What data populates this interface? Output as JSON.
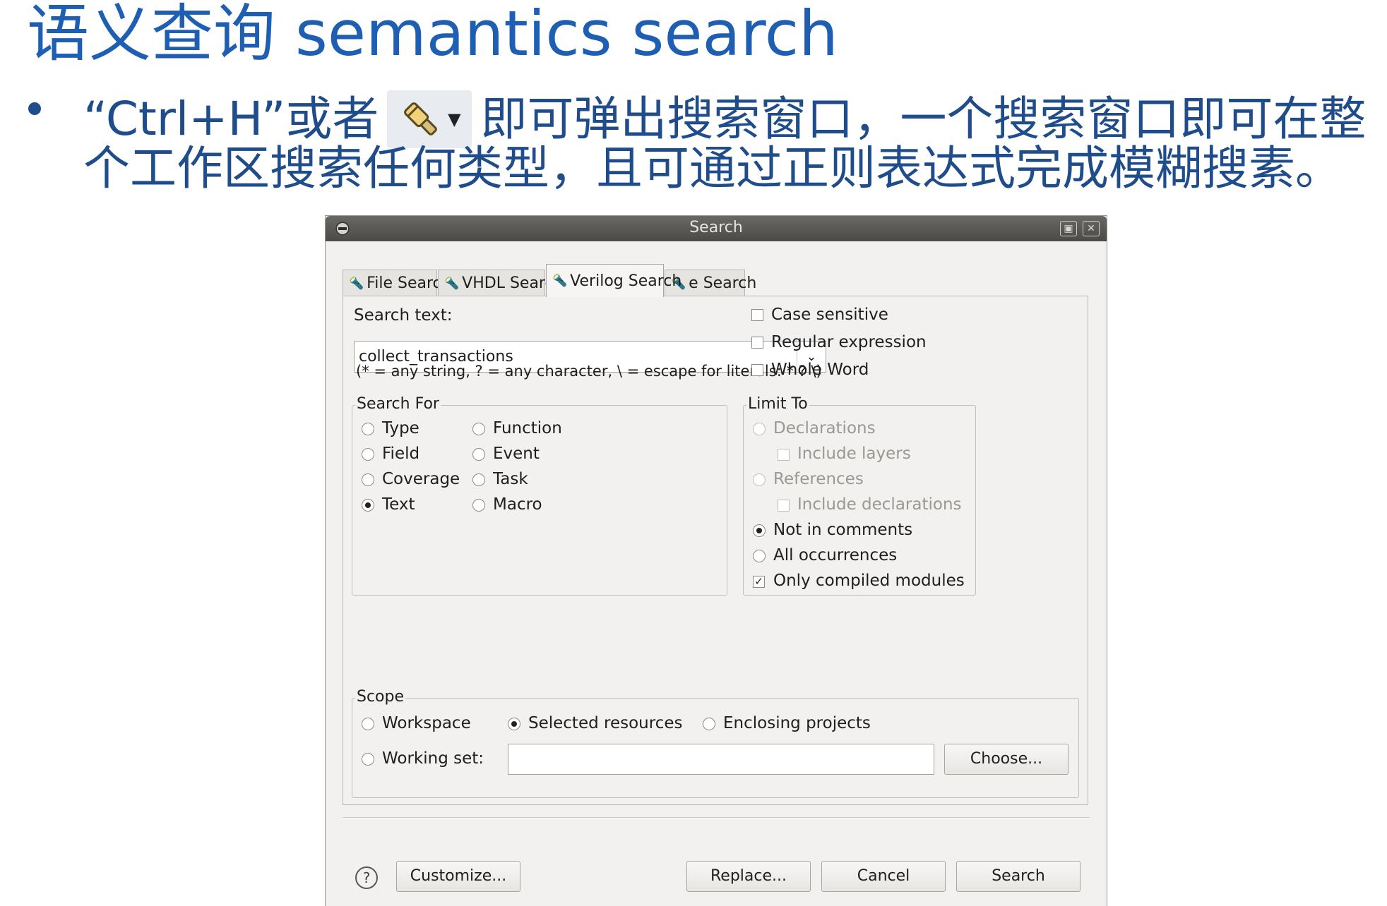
{
  "slide": {
    "title": "语义查询 semantics search",
    "bullet_line1_pre": "“Ctrl+H”或者",
    "bullet_line1_post": "即可弹出搜索窗口，一个搜索窗口即可在整",
    "bullet_line2": "个工作区搜索任何类型，且可通过正则表达式完成模糊搜素。",
    "toolbar_icon": "search-tool-icon"
  },
  "dialog": {
    "title": "Search",
    "tabs": [
      {
        "label": "File Search",
        "icon": "file-search-icon"
      },
      {
        "label": "VHDL Search",
        "icon": "vhdl-search-icon"
      },
      {
        "label": "Verilog Search",
        "icon": "verilog-search-icon",
        "active": true
      },
      {
        "label": "e Search",
        "icon": "e-search-icon"
      }
    ],
    "search_text_label": "Search text:",
    "search_text_value": "collect_transactions",
    "hint": "(* = any string, ? = any character, \\ = escape for literals: * ? \\)",
    "options": {
      "case_sensitive": {
        "label": "Case sensitive",
        "checked": false
      },
      "regular_expression": {
        "label": "Regular expression",
        "checked": false
      },
      "whole_word": {
        "label": "Whole Word",
        "checked": false
      }
    },
    "search_for": {
      "legend": "Search For",
      "items": [
        {
          "label": "Type",
          "selected": false
        },
        {
          "label": "Field",
          "selected": false
        },
        {
          "label": "Coverage",
          "selected": false
        },
        {
          "label": "Text",
          "selected": true
        },
        {
          "label": "Function",
          "selected": false
        },
        {
          "label": "Event",
          "selected": false
        },
        {
          "label": "Task",
          "selected": false
        },
        {
          "label": "Macro",
          "selected": false
        }
      ]
    },
    "limit_to": {
      "legend": "Limit To",
      "declarations": {
        "label": "Declarations",
        "enabled": false
      },
      "include_layers": {
        "label": "Include layers",
        "enabled": false
      },
      "references": {
        "label": "References",
        "enabled": false
      },
      "include_declarations": {
        "label": "Include declarations",
        "enabled": false
      },
      "not_in_comments": {
        "label": "Not in comments",
        "selected": true
      },
      "all_occurrences": {
        "label": "All occurrences",
        "selected": false
      },
      "only_compiled_modules": {
        "label": "Only compiled modules",
        "checked": true
      }
    },
    "scope": {
      "legend": "Scope",
      "workspace": {
        "label": "Workspace",
        "selected": false
      },
      "selected_resources": {
        "label": "Selected resources",
        "selected": true
      },
      "enclosing_projects": {
        "label": "Enclosing projects",
        "selected": false
      },
      "working_set": {
        "label": "Working set:",
        "selected": false,
        "value": ""
      },
      "choose_label": "Choose..."
    },
    "buttons": {
      "customize": "Customize...",
      "replace": "Replace...",
      "cancel": "Cancel",
      "search": "Search"
    },
    "help_label": "?",
    "check_mark": "✓"
  }
}
